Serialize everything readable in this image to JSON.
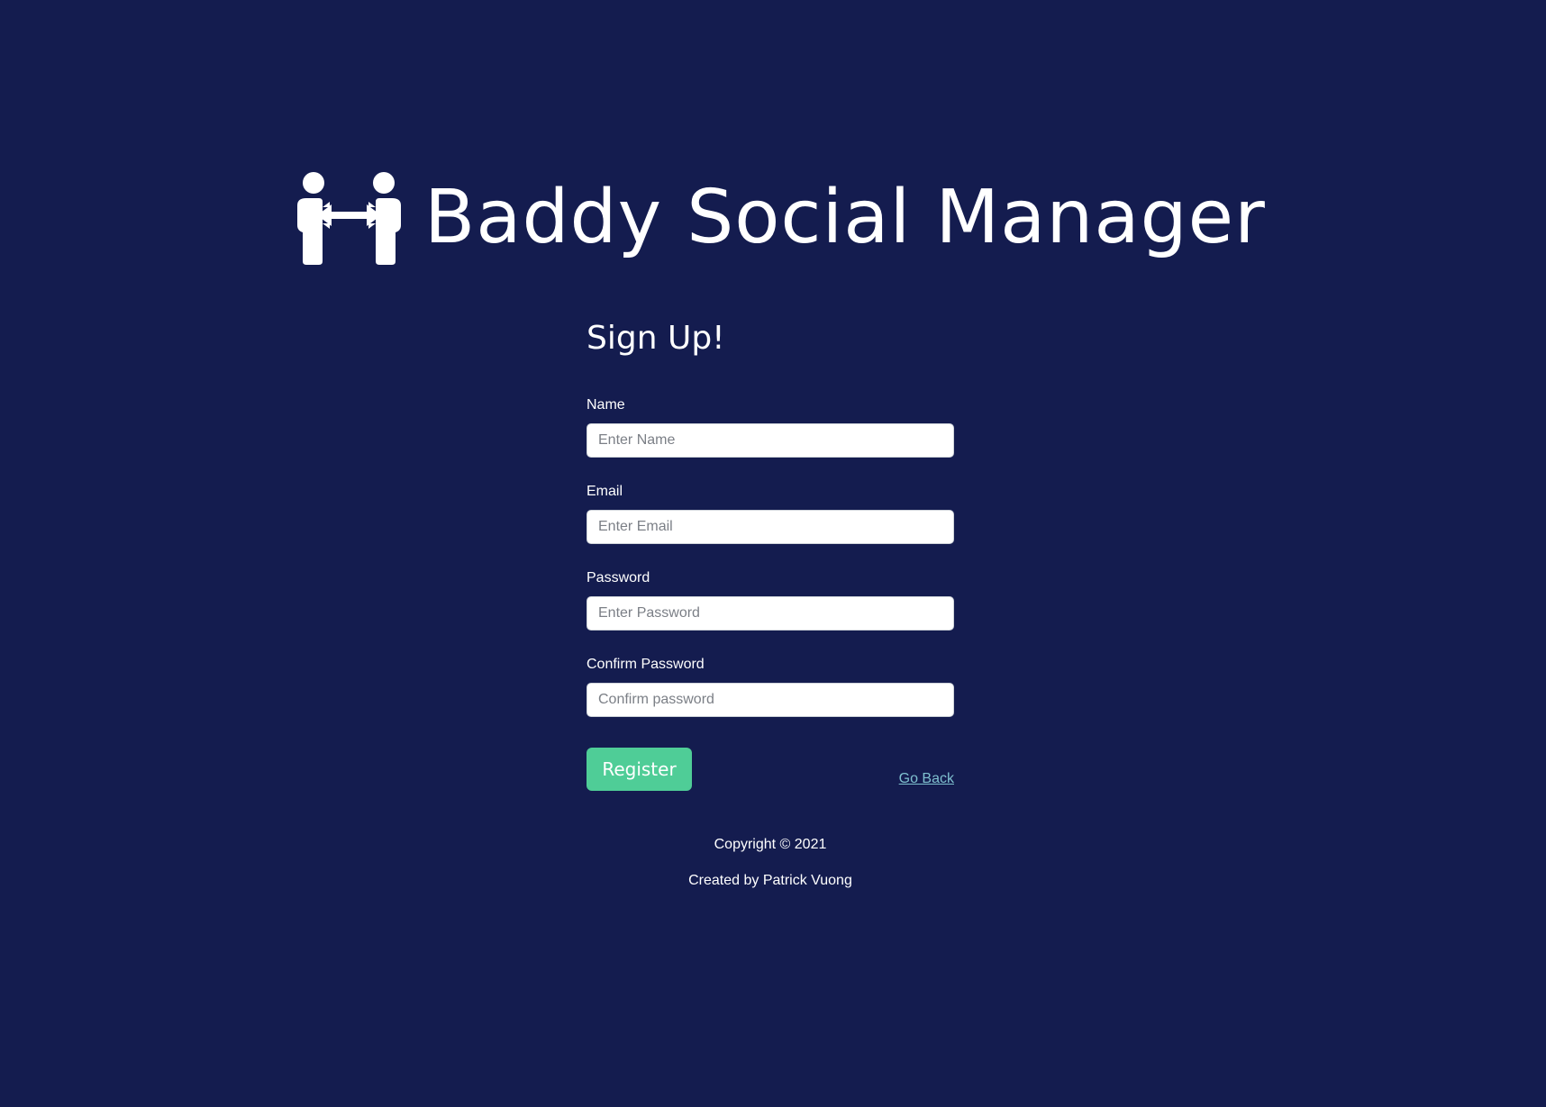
{
  "header": {
    "logo_icon": "people-exchange-icon",
    "title": "Baddy Social Manager"
  },
  "form": {
    "title": "Sign Up!",
    "fields": [
      {
        "label": "Name",
        "placeholder": "Enter Name"
      },
      {
        "label": "Email",
        "placeholder": "Enter Email"
      },
      {
        "label": "Password",
        "placeholder": "Enter Password"
      },
      {
        "label": "Confirm Password",
        "placeholder": "Confirm password"
      }
    ],
    "register_label": "Register",
    "go_back_label": "Go Back"
  },
  "footer": {
    "copyright": "Copyright © 2021",
    "created_by": "Created by Patrick Vuong"
  },
  "colors": {
    "background": "#141c4f",
    "accent": "#4fcd97",
    "link": "#7fc0cf"
  }
}
